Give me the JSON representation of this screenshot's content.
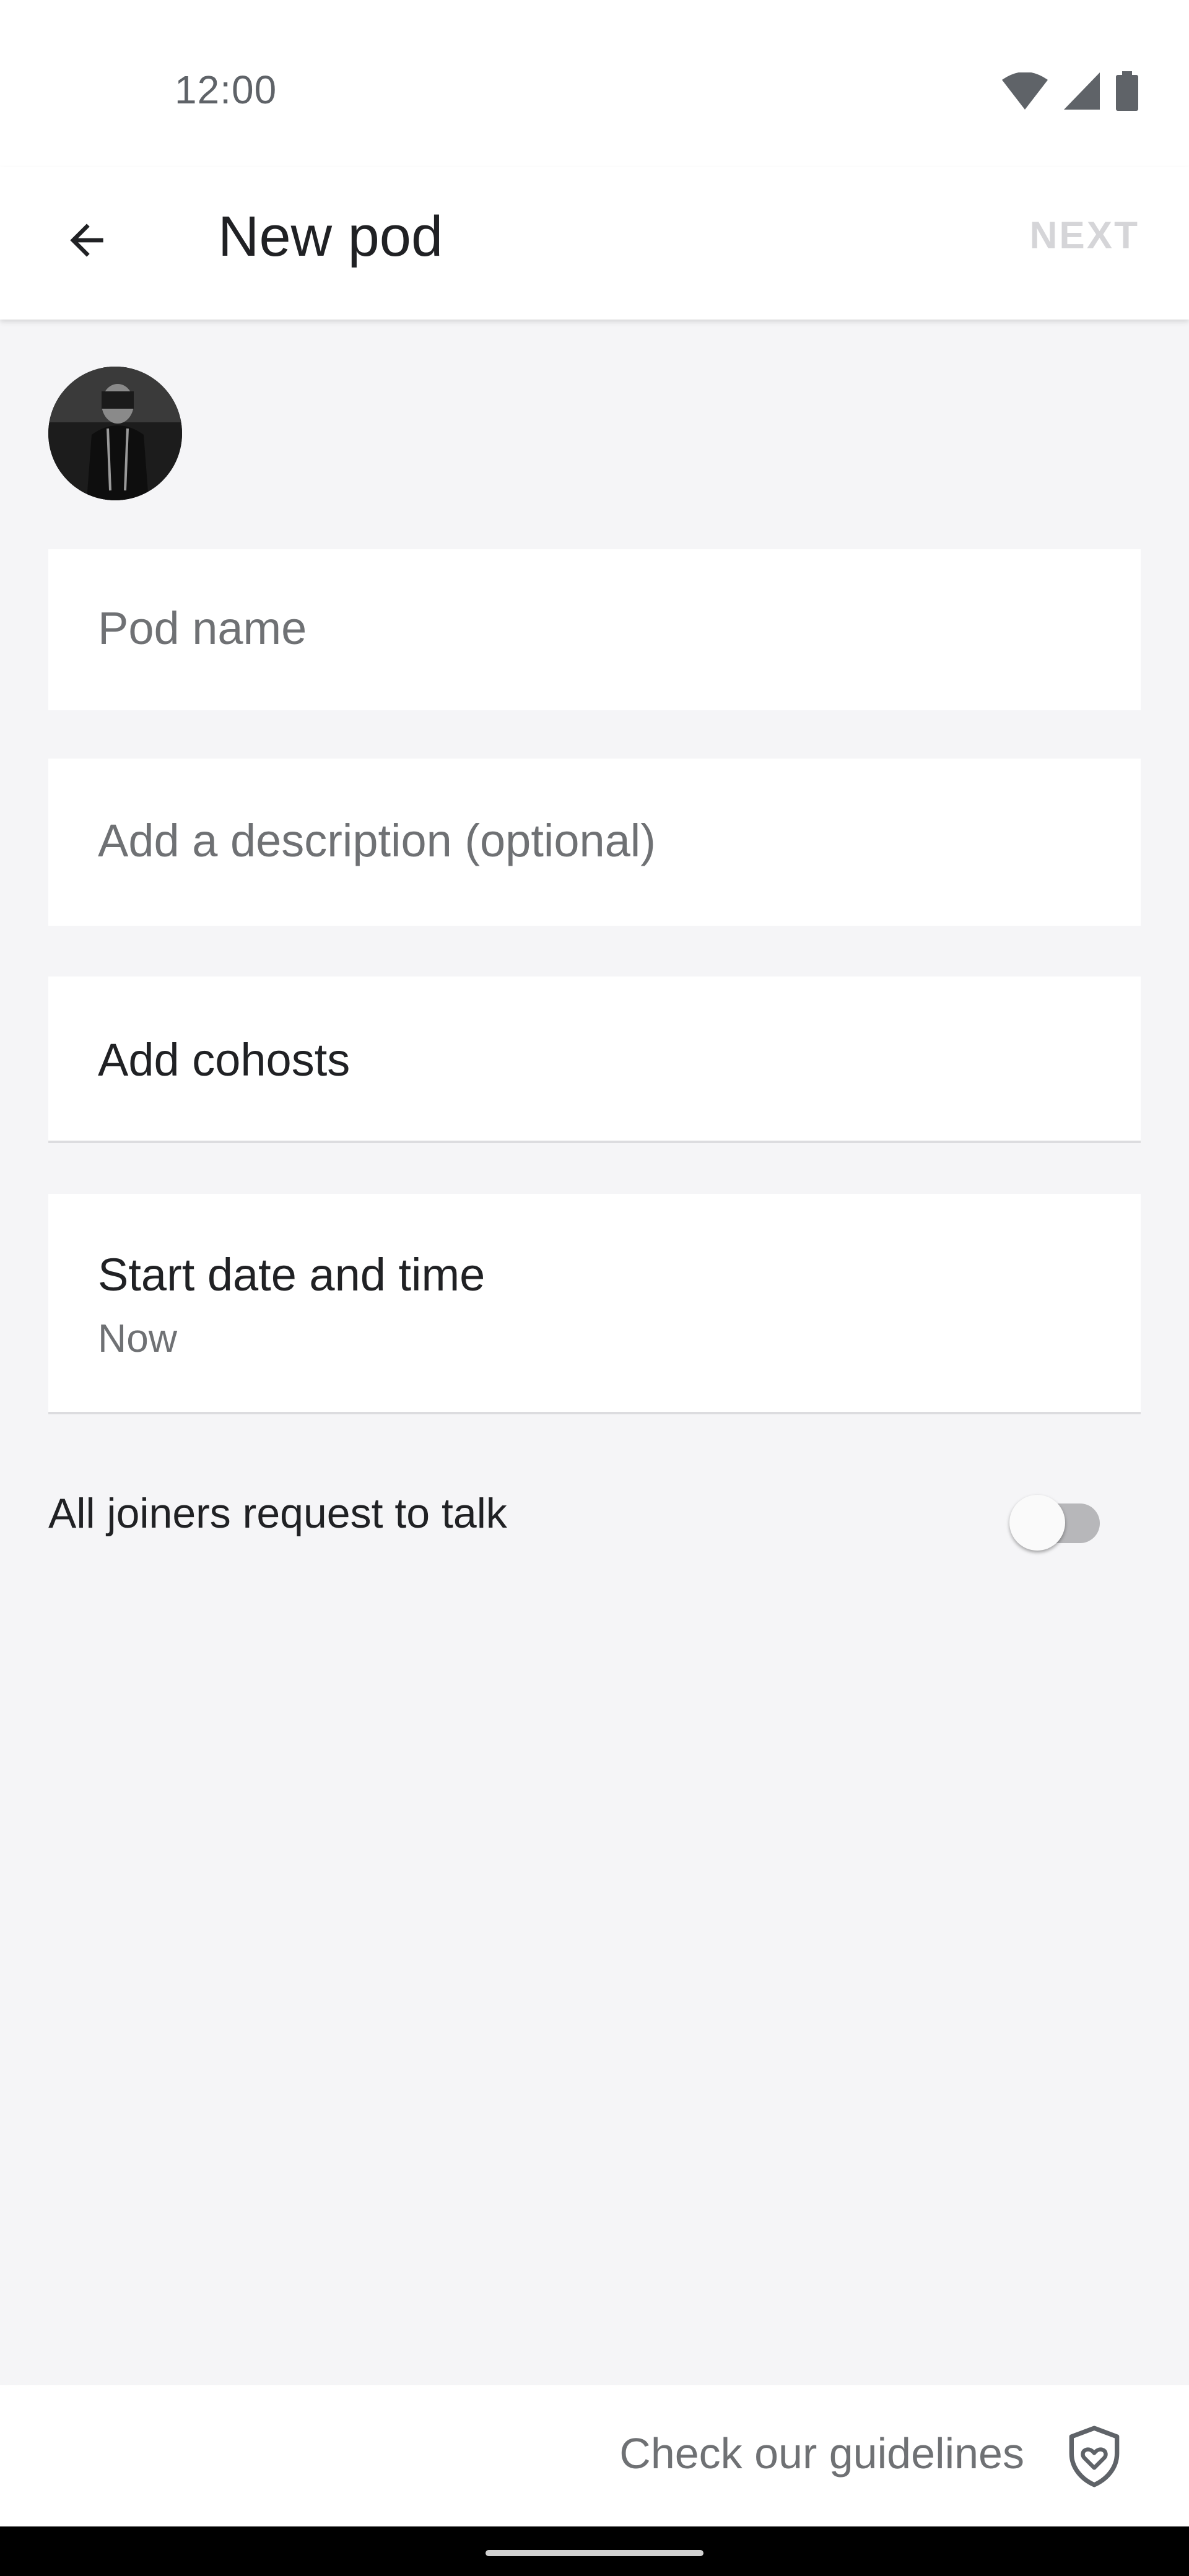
{
  "status_bar": {
    "time": "12:00",
    "icons": [
      "wifi-icon",
      "signal-icon",
      "battery-icon"
    ]
  },
  "app_bar": {
    "back_icon": "arrow-back-icon",
    "title": "New pod",
    "next_label": "NEXT"
  },
  "form": {
    "avatar_alt": "profile-avatar",
    "pod_name_placeholder": "Pod name",
    "description_placeholder": "Add a description (optional)",
    "cohosts_label": "Add cohosts",
    "start_label": "Start date and time",
    "start_value": "Now",
    "toggle_label": "All joiners request to talk",
    "toggle_on": false
  },
  "footer": {
    "guidelines_label": "Check our guidelines",
    "guidelines_icon": "shield-heart-icon"
  },
  "colors": {
    "background": "#f5f5f7",
    "surface": "#ffffff",
    "disabled_text": "#d5d5d8",
    "secondary_text": "#6f7174"
  }
}
